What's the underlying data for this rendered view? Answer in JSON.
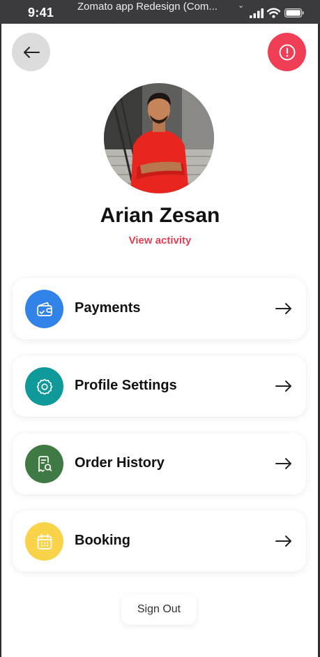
{
  "status_bar": {
    "time": "9:41",
    "window_title": "Zomato app Redesign (Com...",
    "signal_icon": "cellular-signal-icon",
    "wifi_icon": "wifi-icon",
    "battery_icon": "battery-icon"
  },
  "header": {
    "back_icon": "arrow-left-icon",
    "alert_icon": "exclamation-circle-icon"
  },
  "profile": {
    "name": "Arian Zesan",
    "view_activity": "View activity"
  },
  "menu": [
    {
      "label": "Payments",
      "icon": "wallet-icon",
      "color": "#3283e7"
    },
    {
      "label": "Profile Settings",
      "icon": "gear-icon",
      "color": "#10999a"
    },
    {
      "label": "Order History",
      "icon": "receipt-search-icon",
      "color": "#3f7a44"
    },
    {
      "label": "Booking",
      "icon": "calendar-icon",
      "color": "#f9d44a"
    }
  ],
  "sign_out": "Sign Out",
  "colors": {
    "accent": "#ef3e56",
    "link": "#e23f52"
  }
}
